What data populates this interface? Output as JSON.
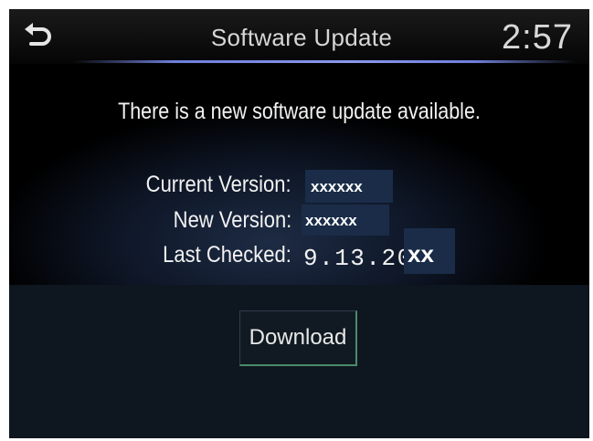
{
  "header": {
    "back_icon": "back-arrow-icon",
    "title": "Software Update",
    "clock": "2:57"
  },
  "message": "There is a new software update available.",
  "info": {
    "current_version_label": "Current Version:",
    "current_version_value": "xxxxxx",
    "new_version_label": "New Version:",
    "new_version_value": "xxxxxx",
    "last_checked_label": "Last Checked:",
    "last_checked_value_prefix": "9.13.20",
    "last_checked_value_suffix": "xx"
  },
  "actions": {
    "download_label": "Download"
  },
  "colors": {
    "accent_line": "#7b8be6",
    "redaction_box": "#1a2c48",
    "button_border_accent": "#4d8a6a"
  }
}
